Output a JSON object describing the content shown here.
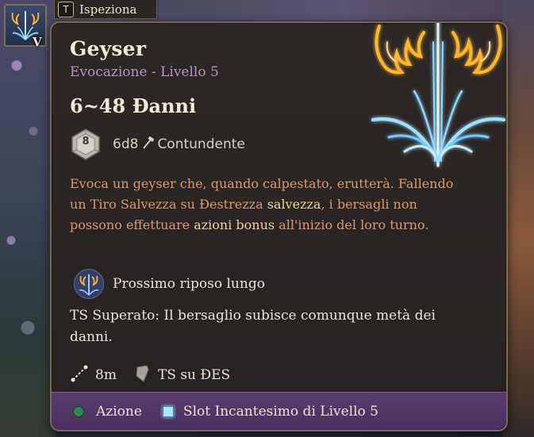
{
  "hotbar": {
    "slot_icon": "geyser-spell-icon",
    "slot_hotkey": "V"
  },
  "inspect": {
    "key": "T",
    "label": "Ispeziona"
  },
  "spell": {
    "name": "Geyser",
    "school_level": "Evocazione - Livello 5",
    "damage_summary": "6~48 Đanni",
    "die_face": "8",
    "dice": "6d8",
    "damage_type": "Contundente",
    "damage_type_icon": "hammer-icon",
    "description": {
      "part1": "Evoca un geyser che, quando calpestato, erutterà. Fallendo un Tiro Salvezza su Đestrezza ",
      "kw1": "salvezza",
      "part2": ", i bersagli non possono effettuare ",
      "kw2": "azioni bonus",
      "part3": " all'inizio del loro turno."
    },
    "recharge": "Prossimo riposo lungo",
    "save_note": "TS Superato: Il bersaglio subisce comunque metà dei danni.",
    "range": "8m",
    "save": "TS su ĐES",
    "cost_action": "Azione",
    "cost_slot": "Slot Incantesimo di Livello 5"
  },
  "colors": {
    "title": "#f1ead9",
    "subtitle": "#b894c2",
    "description": "#d99a6c",
    "keyword": "#f0d39a",
    "footer": "#4a2f5e",
    "action_dot": "#2f8a4a",
    "slot_square": "#a8e8ff"
  }
}
